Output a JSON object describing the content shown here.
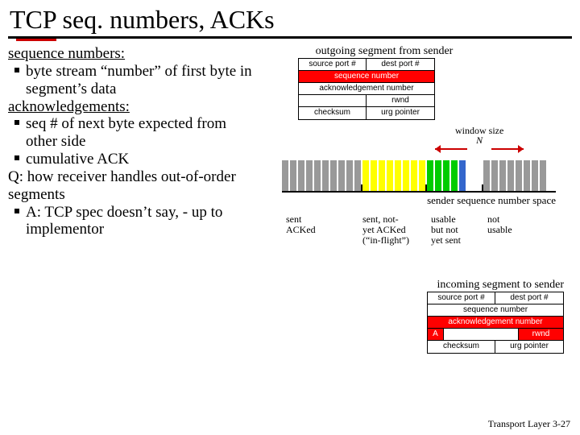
{
  "title": "TCP seq. numbers, ACKs",
  "left": {
    "h1": "sequence numbers:",
    "b1": "byte stream “number” of first byte in segment’s data",
    "h2": "acknowledgements:",
    "b2": "seq # of next byte expected from other side",
    "b3": "cumulative ACK",
    "q": "Q: how receiver handles out-of-order segments",
    "b4": "A: TCP spec doesn’t say, - up to implementor"
  },
  "outgoing": {
    "caption": "outgoing segment from sender",
    "src": "source port #",
    "dst": "dest port #",
    "seq": "sequence number",
    "ack": "acknowledgement number",
    "rwnd": "rwnd",
    "chk": "checksum",
    "urg": "urg pointer"
  },
  "window": {
    "label": "window size",
    "var": "N"
  },
  "stripe": {
    "caption": "sender sequence number space",
    "lab1": "sent ACKed",
    "lab2a": "sent, not-",
    "lab2b": "yet ACKed",
    "lab2c": "(“in-flight”)",
    "lab3a": "usable",
    "lab3b": "but not",
    "lab3c": "yet sent",
    "lab4a": "not",
    "lab4b": "usable"
  },
  "incoming": {
    "caption": "incoming segment to sender",
    "src": "source port #",
    "dst": "dest port #",
    "seq": "sequence number",
    "ack": "acknowledgement number",
    "a": "A",
    "rwnd": "rwnd",
    "chk": "checksum",
    "urg": "urg pointer"
  },
  "footer": "Transport Layer 3-27"
}
